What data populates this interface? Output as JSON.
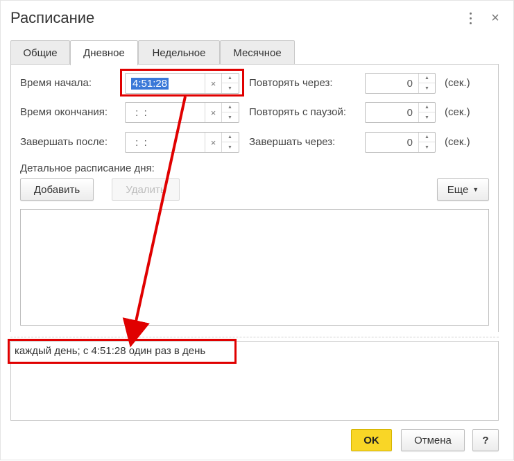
{
  "window": {
    "title": "Расписание",
    "more_icon": "vertical-dots-icon",
    "close_label": "×"
  },
  "tabs": [
    {
      "label": "Общие",
      "active": false
    },
    {
      "label": "Дневное",
      "active": true
    },
    {
      "label": "Недельное",
      "active": false
    },
    {
      "label": "Месячное",
      "active": false
    }
  ],
  "left_fields": {
    "start_time": {
      "label": "Время начала:",
      "value": "4:51:28"
    },
    "end_time": {
      "label": "Время окончания:",
      "value": " :  :"
    },
    "finish_after": {
      "label": "Завершать после:",
      "value": " :  :"
    },
    "clear_symbol": "×"
  },
  "right_fields": {
    "repeat_every": {
      "label": "Повторять через:",
      "value": "0",
      "unit": "(сек.)"
    },
    "repeat_pause": {
      "label": "Повторять с паузой:",
      "value": "0",
      "unit": "(сек.)"
    },
    "finish_in": {
      "label": "Завершать через:",
      "value": "0",
      "unit": "(сек.)"
    }
  },
  "detail": {
    "label": "Детальное расписание дня:",
    "add_button": "Добавить",
    "delete_button": "Удалить",
    "more_button": "Еще"
  },
  "summary": {
    "text": "каждый день; с 4:51:28 один раз в день"
  },
  "footer": {
    "ok_button": "OK",
    "cancel_button": "Отмена",
    "help_button": "?"
  },
  "colors": {
    "highlight": "#e00000",
    "ok_button": "#f9d626",
    "selection": "#3a78d8"
  }
}
